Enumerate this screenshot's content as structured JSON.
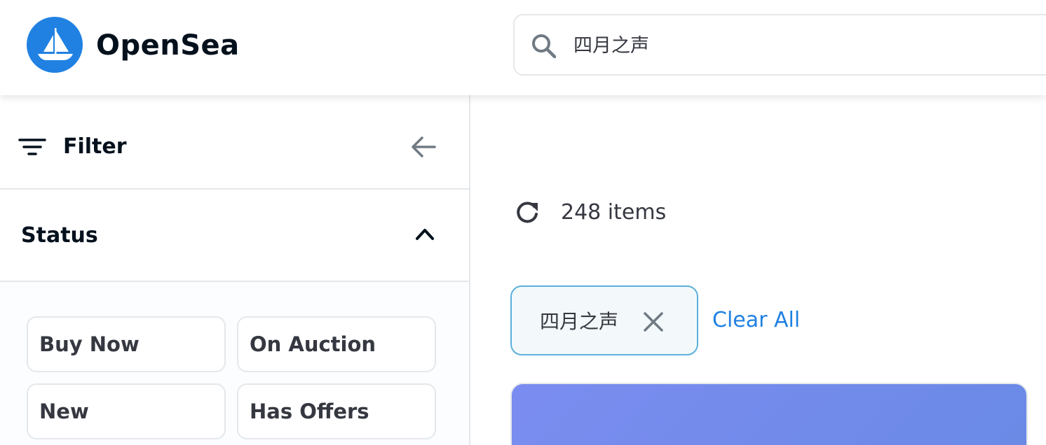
{
  "header": {
    "brand": "OpenSea",
    "logo_icon": "opensea-ship-logo",
    "search": {
      "value": "四月之声",
      "icon": "search-icon"
    }
  },
  "sidebar": {
    "filter_label": "Filter",
    "status": {
      "label": "Status",
      "expanded": true,
      "options": [
        "Buy Now",
        "On Auction",
        "New",
        "Has Offers"
      ]
    }
  },
  "main": {
    "items_count": "248 items",
    "active_filter": "四月之声",
    "clear_all_label": "Clear All"
  },
  "colors": {
    "accent": "#2081e2",
    "chip_border": "#5bb0db",
    "chip_bg": "#f3f9fb",
    "text_primary": "#04111d",
    "text_secondary": "#353840",
    "border": "#e5e8eb"
  }
}
